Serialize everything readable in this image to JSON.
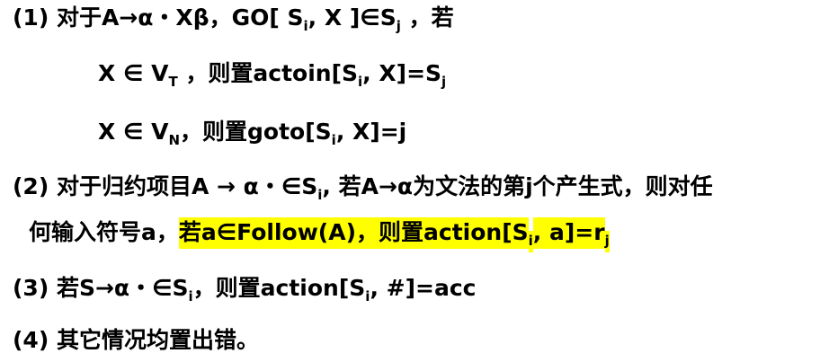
{
  "rules": [
    {
      "label": "(1)",
      "segments": [
        {
          "t": " 对于A→α・Xβ，GO[ S"
        },
        {
          "t": "i",
          "sub": true
        },
        {
          "t": ", X ]∈S"
        },
        {
          "t": "j",
          "sub": true
        },
        {
          "t": " ，若"
        }
      ]
    },
    {
      "label": "",
      "segments": [
        {
          "t": "X ∈ V"
        },
        {
          "t": "T",
          "sub": true
        },
        {
          "t": " ，则置actoin[S"
        },
        {
          "t": "i",
          "sub": true
        },
        {
          "t": ", X]=S"
        },
        {
          "t": "j",
          "sub": true
        }
      ]
    },
    {
      "label": "",
      "segments": [
        {
          "t": "X ∈ V"
        },
        {
          "t": "N",
          "sub": true
        },
        {
          "t": "，则置goto[S"
        },
        {
          "t": "i",
          "sub": true
        },
        {
          "t": ", X]=j"
        }
      ]
    },
    {
      "label": "(2)",
      "segments": [
        {
          "t": "  对于归约项目A → α・∈S"
        },
        {
          "t": "i",
          "sub": true
        },
        {
          "t": ", 若A→α为文法的第j个产生式，则对任"
        }
      ]
    },
    {
      "label": "",
      "segments": [
        {
          "t": "何输入符号a，"
        },
        {
          "t": "若a∈Follow(A)，则置action[S",
          "hl": true
        },
        {
          "t": "i",
          "sub": true,
          "hl": true
        },
        {
          "t": ", a]=r",
          "hl": true
        },
        {
          "t": "j",
          "sub": true,
          "hl": true
        }
      ]
    },
    {
      "label": "(3)",
      "segments": [
        {
          "t": " 若S→α・∈S"
        },
        {
          "t": "i",
          "sub": true
        },
        {
          "t": "，则置action[S"
        },
        {
          "t": "i",
          "sub": true
        },
        {
          "t": ", #]=acc"
        }
      ]
    },
    {
      "label": "(4)",
      "segments": [
        {
          "t": " 其它情况均置出错。"
        }
      ]
    }
  ],
  "highlight_color": "#ffff00"
}
